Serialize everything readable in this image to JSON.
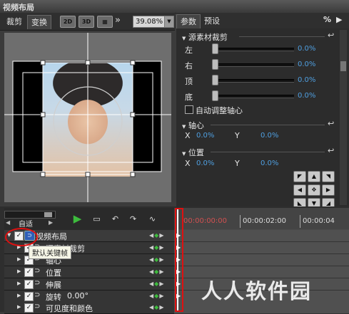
{
  "window": {
    "title": "视频布局"
  },
  "left_tabs": {
    "crop": "裁剪",
    "transform": "变换"
  },
  "mode_buttons": {
    "b2d": "2D",
    "b3d": "3D"
  },
  "zoom": {
    "value": "39.08%"
  },
  "right_tabs": {
    "params": "参数",
    "presets": "预设"
  },
  "percent_icon": "%",
  "sections": {
    "source_crop": {
      "title": "源素材裁剪",
      "rows": [
        {
          "label": "左",
          "value": "0.0%"
        },
        {
          "label": "右",
          "value": "0.0%"
        },
        {
          "label": "顶",
          "value": "0.0%"
        },
        {
          "label": "底",
          "value": "0.0%"
        }
      ],
      "auto_axis_label": "自动调整轴心"
    },
    "axis": {
      "title": "轴心",
      "x_label": "X",
      "x_value": "0.0%",
      "y_label": "Y",
      "y_value": "0.0%"
    },
    "position": {
      "title": "位置",
      "x_label": "X",
      "x_value": "0.0%",
      "y_label": "Y",
      "y_value": "0.0%"
    }
  },
  "timeline_head": {
    "auto_label": "自适",
    "timecodes": [
      "00:00:00:00",
      "00:00:02:00",
      "00:00:04"
    ]
  },
  "layers": [
    {
      "label": "视频布局"
    },
    {
      "label": "源素材裁剪"
    },
    {
      "label": "轴心"
    },
    {
      "label": "位置"
    },
    {
      "label": "伸展"
    },
    {
      "label": "旋转",
      "extra": "0.00°"
    },
    {
      "label": "可见度和颜色"
    }
  ],
  "tooltip": "默认关键帧",
  "watermark": "人人软件园",
  "colors": {
    "accent_blue": "#4f9fe0",
    "highlight_red": "#e01010",
    "play_green": "#3dbb3d"
  },
  "icons": [
    "play-icon",
    "reset-icon",
    "keyframe-icon",
    "checkbox-icon",
    "arrow-up-icon",
    "arrow-down-icon",
    "arrow-left-icon",
    "arrow-right-icon",
    "center-icon"
  ]
}
